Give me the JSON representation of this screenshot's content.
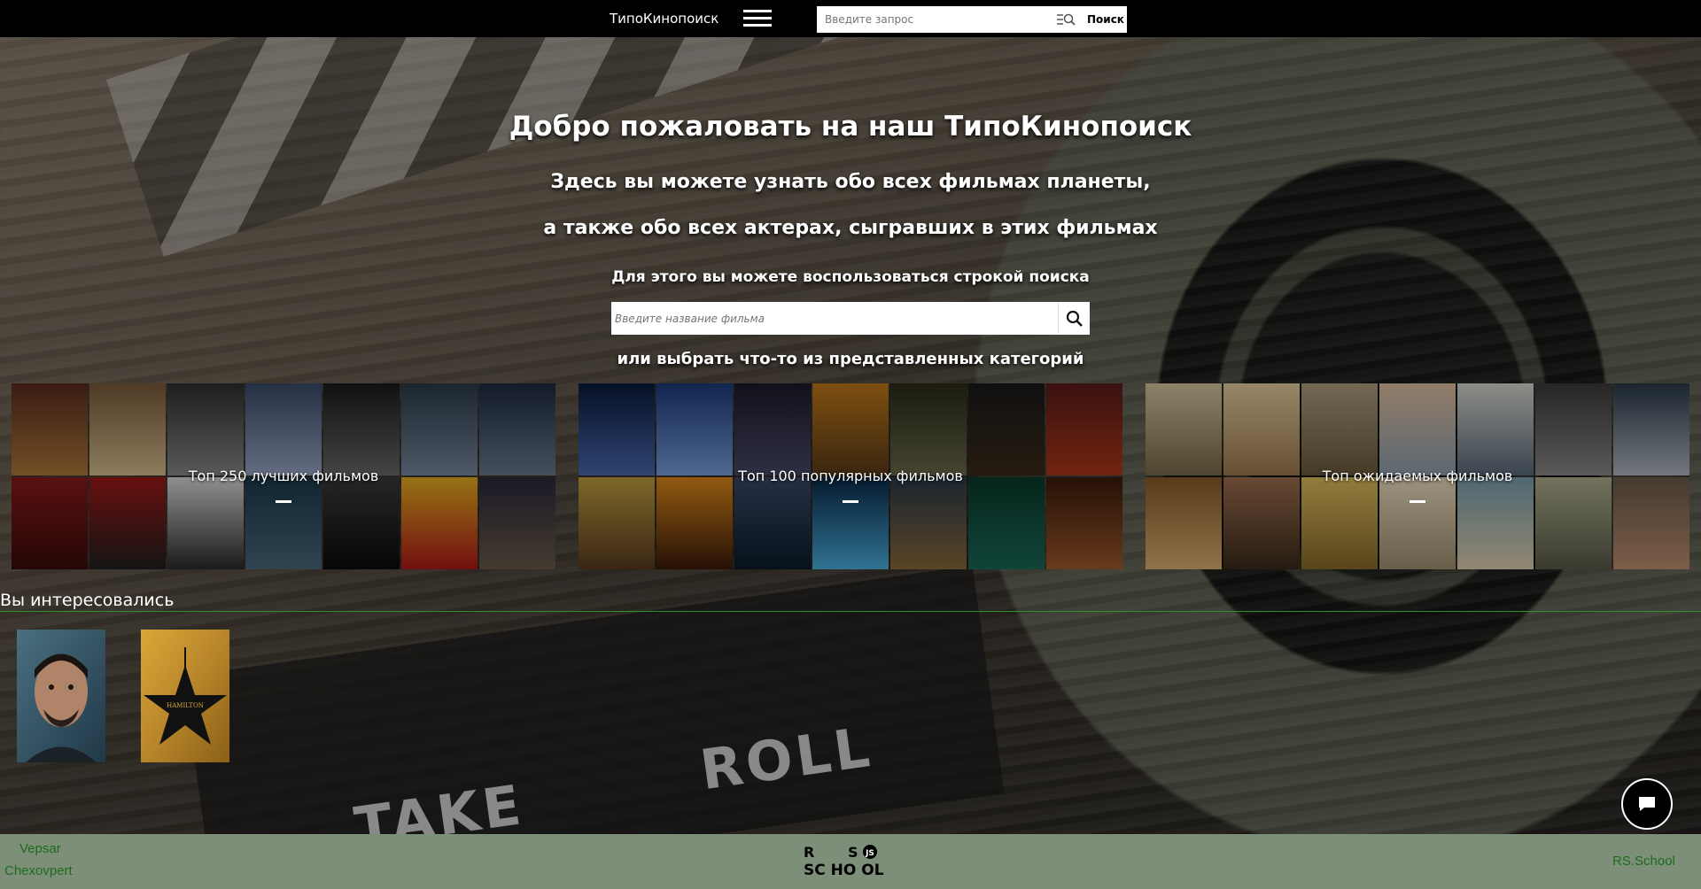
{
  "header": {
    "brand": "ТипоКинопоиск",
    "search_placeholder": "Введите запрос",
    "search_button": "Поиск"
  },
  "hero": {
    "title": "Добро пожаловать на наш ТипоКинопоиск",
    "line1": "Здесь вы можете узнать обо всех фильмах планеты,",
    "line2": "а также обо всех актерах, сыгравших в этих фильмах",
    "line3": "Для этого вы можете воспользоваться строкой поиска",
    "search_placeholder": "Введите название фильма",
    "line4": "или выбрать что-то из представленных категорий"
  },
  "background": {
    "roll_text": "ROLL",
    "take_text": "TAKE"
  },
  "categories": [
    {
      "label": "Топ 250 лучших фильмов"
    },
    {
      "label": "Топ 100 популярных фильмов"
    },
    {
      "label": "Топ ожидаемых фильмов"
    }
  ],
  "interested": {
    "title": "Вы интересовались",
    "items": [
      {
        "icon": "actor-portrait"
      },
      {
        "icon": "hamilton-poster",
        "caption": "HAMILTON"
      }
    ]
  },
  "footer": {
    "author1": "Vepsar",
    "author2": "Chexovpert",
    "logo_text": "RS SCHOOL JS",
    "rs_link": "RS.School"
  },
  "colors": {
    "topbar": "#000000",
    "footer": "#7d8f78",
    "footer_link": "#1d6b1d",
    "divider": "#2f8f2f"
  }
}
